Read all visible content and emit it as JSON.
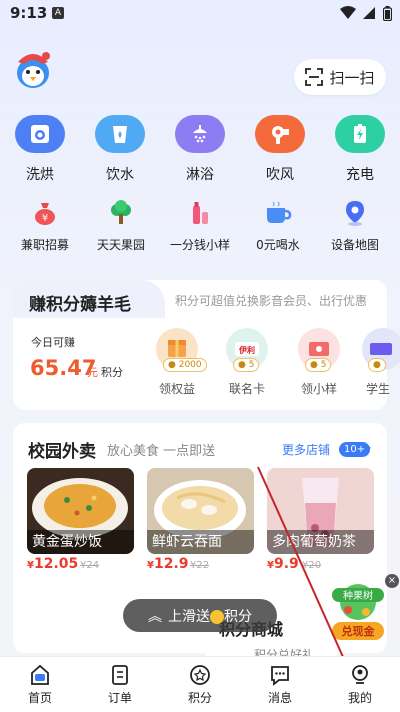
{
  "status_bar": {
    "time": "9:13",
    "notification": "A"
  },
  "header": {
    "scan_label": "扫一扫"
  },
  "services": [
    {
      "label": "洗烘",
      "icon": "washer-icon",
      "color": "#4e80f5"
    },
    {
      "label": "饮水",
      "icon": "water-cup-icon",
      "color": "#4fa9f3"
    },
    {
      "label": "淋浴",
      "icon": "shower-icon",
      "color": "#8e7cf3"
    },
    {
      "label": "吹风",
      "icon": "hair-dryer-icon",
      "color": "#f56a3a"
    },
    {
      "label": "充电",
      "icon": "battery-charge-icon",
      "color": "#2fcfa4"
    }
  ],
  "mini_services": [
    {
      "label": "兼职招募",
      "icon": "money-bag-icon"
    },
    {
      "label": "天天果园",
      "icon": "tree-icon"
    },
    {
      "label": "一分钱小样",
      "icon": "cosmetics-icon"
    },
    {
      "label": "0元喝水",
      "icon": "coffee-cup-icon"
    },
    {
      "label": "设备地图",
      "icon": "map-pin-icon"
    }
  ],
  "points": {
    "title": "赚积分薅羊毛",
    "description": "积分可超值兑换影音会员、出行优惠",
    "today_label": "今日可赚",
    "today_amount": "65.47",
    "today_unit": "元",
    "today_unit2": "积分",
    "perks": [
      {
        "label": "领权益",
        "badge": "2000"
      },
      {
        "label": "联名卡",
        "badge": "5",
        "logo": "伊利"
      },
      {
        "label": "领小样",
        "badge": "5"
      },
      {
        "label": "学生",
        "badge": ""
      }
    ]
  },
  "takeout": {
    "title": "校园外卖",
    "subtitle": "放心美食 一点即送",
    "more_label": "更多店铺",
    "more_count": "10+",
    "items": [
      {
        "name": "黄金蛋炒饭",
        "price": "12.05",
        "old_price": "¥24"
      },
      {
        "name": "鲜虾云吞面",
        "price": "12.9",
        "old_price": "¥22"
      },
      {
        "name": "多肉葡萄奶茶",
        "price": "9.9",
        "old_price": "¥20"
      }
    ]
  },
  "floating": {
    "slide_hint_pre": "上滑送",
    "slide_hint_post": "积分",
    "points_mall": "积分商城",
    "points_mall_sub": "积分兑好礼",
    "fruit_tree": "种果树",
    "fruit_cash": "兑现金",
    "close": "×"
  },
  "bottom_nav": [
    {
      "label": "首页",
      "icon": "home-icon"
    },
    {
      "label": "订单",
      "icon": "order-icon"
    },
    {
      "label": "积分",
      "icon": "points-star-icon"
    },
    {
      "label": "消息",
      "icon": "message-icon"
    },
    {
      "label": "我的",
      "icon": "profile-icon"
    }
  ]
}
